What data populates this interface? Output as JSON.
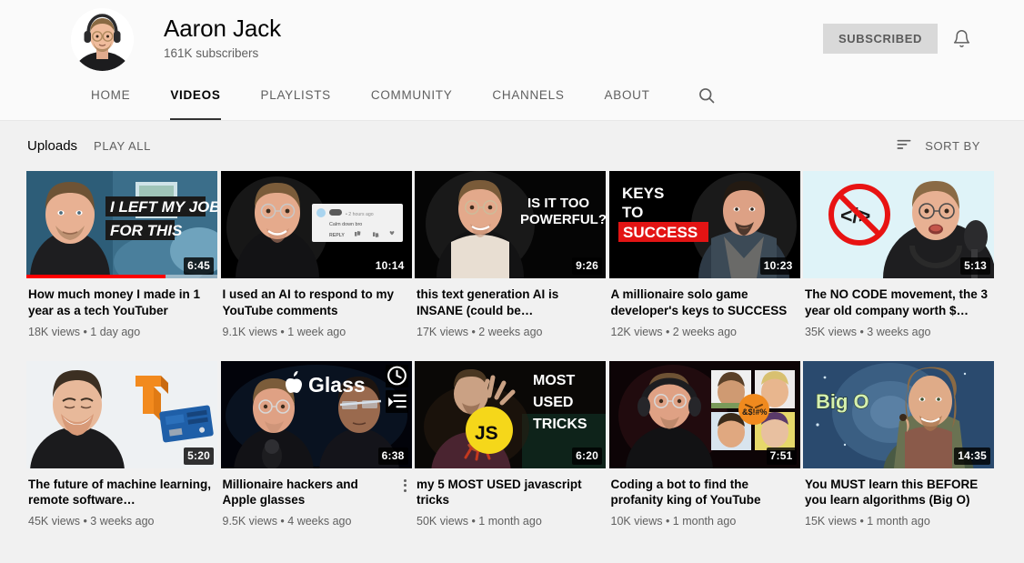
{
  "theme": {
    "page_bg": "#f1f1f1",
    "header_bg": "#fafafa",
    "text_primary": "#030303",
    "text_secondary": "#606060",
    "accent_red": "#ff0000",
    "subscribed_bg": "#d9d9d9"
  },
  "channel": {
    "name": "Aaron Jack",
    "subscriber_count": "161K subscribers",
    "avatar_icon": "channel-avatar-photo",
    "subscribe_label": "SUBSCRIBED",
    "bell_icon": "notification-bell-icon"
  },
  "tabs": [
    {
      "label": "HOME",
      "active": false
    },
    {
      "label": "VIDEOS",
      "active": true
    },
    {
      "label": "PLAYLISTS",
      "active": false
    },
    {
      "label": "COMMUNITY",
      "active": false
    },
    {
      "label": "CHANNELS",
      "active": false
    },
    {
      "label": "ABOUT",
      "active": false
    }
  ],
  "tab_search_icon": "search-icon",
  "uploads_bar": {
    "section_label": "Uploads",
    "play_all_label": "PLAY ALL",
    "sort_by_label": "SORT BY",
    "sort_icon": "sort-lines-icon"
  },
  "videos": [
    {
      "title": "How much money I made in 1 year as a tech YouTuber",
      "duration": "6:45",
      "views": "18K views",
      "published": "1 day ago",
      "stats": "18K views • 1 day ago",
      "thumb_text": [
        "I LEFT MY JOB",
        "FOR THIS"
      ],
      "progress_percent": 73,
      "hovered": false
    },
    {
      "title": "I used an AI to respond to my YouTube comments",
      "duration": "10:14",
      "views": "9.1K views",
      "published": "1 week ago",
      "stats": "9.1K views • 1 week ago",
      "thumb_text": [
        "Calm down bro",
        "REPLY"
      ],
      "progress_percent": 0,
      "hovered": false
    },
    {
      "title": "this text generation AI is INSANE (could be…",
      "duration": "9:26",
      "views": "17K views",
      "published": "2 weeks ago",
      "stats": "17K views • 2 weeks ago",
      "thumb_text": [
        "IS IT TOO",
        "POWERFUL?"
      ],
      "progress_percent": 0,
      "hovered": false
    },
    {
      "title": "A millionaire solo game developer's keys to SUCCESS",
      "duration": "10:23",
      "views": "12K views",
      "published": "2 weeks ago",
      "stats": "12K views • 2 weeks ago",
      "thumb_text": [
        "KEYS",
        "TO",
        "SUCCESS"
      ],
      "progress_percent": 0,
      "hovered": false
    },
    {
      "title": "The NO CODE movement, the 3 year old company worth $…",
      "duration": "5:13",
      "views": "35K views",
      "published": "3 weeks ago",
      "stats": "35K views • 3 weeks ago",
      "thumb_text": [
        "</>"
      ],
      "progress_percent": 0,
      "hovered": false
    },
    {
      "title": "The future of machine learning, remote software…",
      "duration": "5:20",
      "views": "45K views",
      "published": "3 weeks ago",
      "stats": "45K views • 3 weeks ago",
      "thumb_text": [],
      "progress_percent": 0,
      "hovered": false
    },
    {
      "title": "Millionaire hackers and Apple glasses",
      "duration": "6:38",
      "views": "9.5K views",
      "published": "4 weeks ago",
      "stats": "9.5K views • 4 weeks ago",
      "thumb_text": [
        "Glass"
      ],
      "progress_percent": 0,
      "hovered": true,
      "hover_actions": [
        "watch-later-icon",
        "add-to-queue-icon"
      ],
      "menu_icon": "more-vertical-icon"
    },
    {
      "title": "my 5 MOST USED javascript tricks",
      "duration": "6:20",
      "views": "50K views",
      "published": "1 month ago",
      "stats": "50K views • 1 month ago",
      "thumb_text": [
        "MOST",
        "USED",
        "TRICKS",
        "JS"
      ],
      "progress_percent": 0,
      "hovered": false
    },
    {
      "title": "Coding a bot to find the profanity king of YouTube",
      "duration": "7:51",
      "views": "10K views",
      "published": "1 month ago",
      "stats": "10K views • 1 month ago",
      "thumb_text": [
        "&$!#%"
      ],
      "progress_percent": 0,
      "hovered": false
    },
    {
      "title": "You MUST learn this BEFORE you learn algorithms (Big O)",
      "duration": "14:35",
      "views": "15K views",
      "published": "1 month ago",
      "stats": "15K views • 1 month ago",
      "thumb_text": [
        "Big O"
      ],
      "progress_percent": 0,
      "hovered": false
    }
  ]
}
